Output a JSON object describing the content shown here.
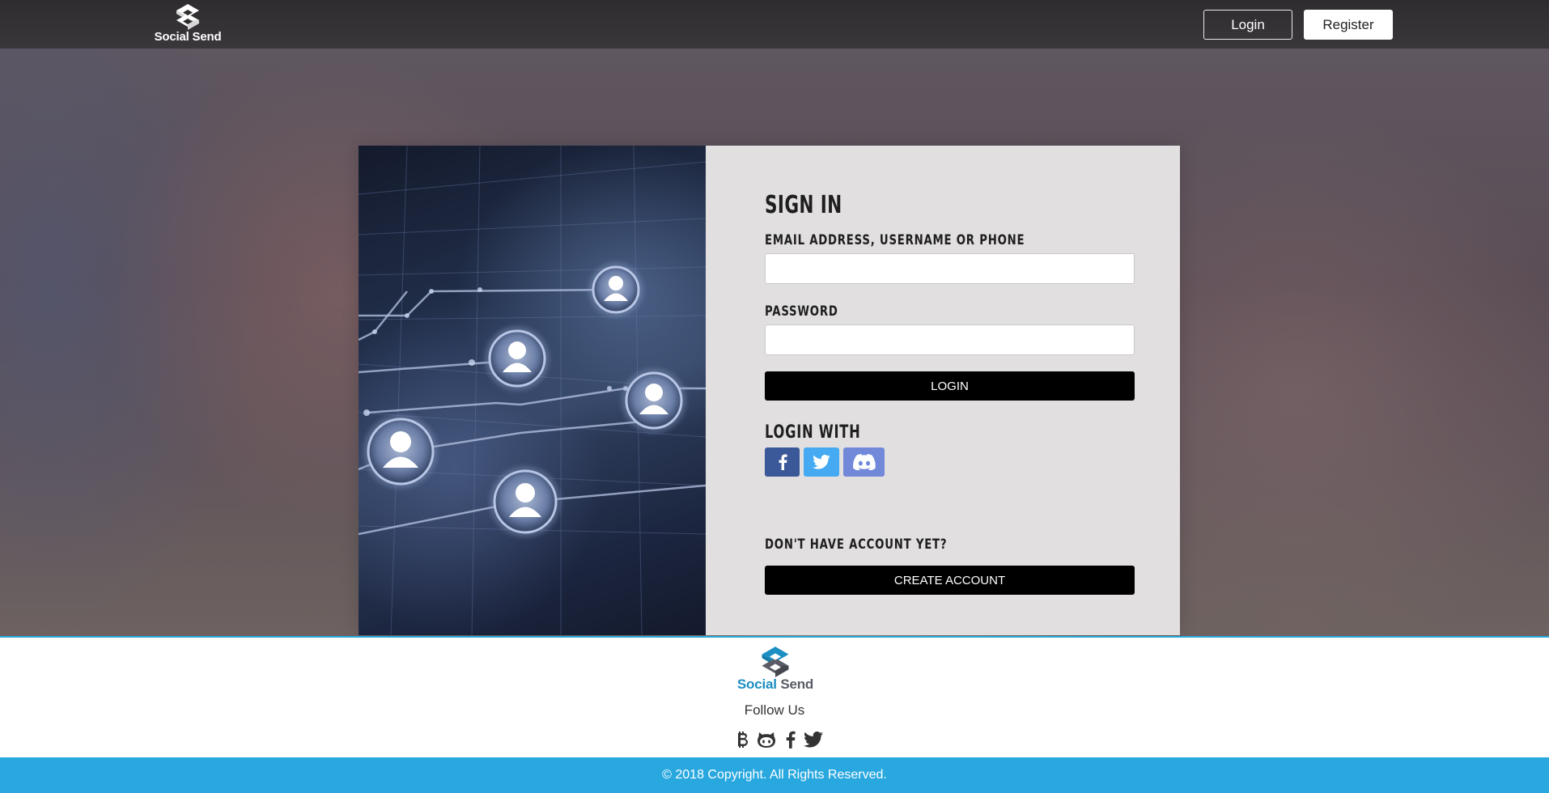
{
  "header": {
    "brand_name": "Social Send",
    "login_label": "Login",
    "register_label": "Register"
  },
  "signin": {
    "title": "SIGN IN",
    "email_label": "EMAIL ADDRESS, USERNAME OR PHONE",
    "email_value": "",
    "password_label": "PASSWORD",
    "password_value": "",
    "login_button": "LOGIN",
    "login_with_label": "LOGIN WITH",
    "social_buttons": [
      {
        "icon": "facebook-icon",
        "color": "#3b5998"
      },
      {
        "icon": "twitter-icon",
        "color": "#45aaf2"
      },
      {
        "icon": "discord-icon",
        "color": "#7289da"
      }
    ],
    "no_account_label": "DON'T HAVE ACCOUNT YET?",
    "create_account_button": "CREATE ACCOUNT"
  },
  "footer": {
    "brand_social": "Social",
    "brand_send": "Send",
    "follow_label": "Follow Us",
    "follow_icons": [
      "bitcoin-icon",
      "github-icon",
      "facebook-icon",
      "twitter-icon"
    ],
    "copyright": "© 2018 Copyright. All Rights Reserved."
  },
  "colors": {
    "accent": "#29a8e0",
    "brand_blue": "#1b8fc2",
    "brand_gray": "#5a5d66",
    "button_black": "#000000",
    "form_bg": "#e1dfe0"
  }
}
